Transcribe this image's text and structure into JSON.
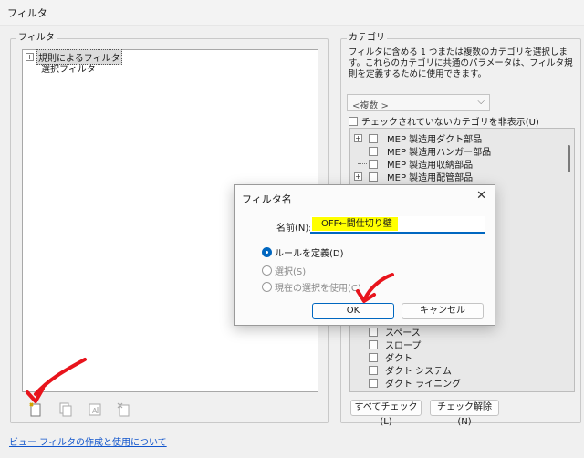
{
  "window": {
    "title": "フィルタ"
  },
  "filters_panel": {
    "label": "フィルタ",
    "tree": [
      {
        "label": "規則によるフィルタ",
        "expand": "+"
      },
      {
        "label": "選択フィルタ"
      }
    ]
  },
  "link": {
    "text": "ビュー フィルタの作成と使用について"
  },
  "categories_panel": {
    "label": "カテゴリ",
    "description": "フィルタに含める 1 つまたは複数のカテゴリを選択します。これらのカテゴリに共通のパラメータは、フィルタ規則を定義するために使用できます。",
    "combo_value": "<複数 >",
    "hide_unchecked_label": "チェックされていないカテゴリを非表示(U)",
    "list_top": [
      {
        "label": "MEP 製造用ダクト部品",
        "expand": "+"
      },
      {
        "label": "MEP 製造用ハンガー部品",
        "expand": ""
      },
      {
        "label": "MEP 製造用収納部品",
        "expand": ""
      },
      {
        "label": "MEP 製造用配管部品",
        "expand": "+"
      }
    ],
    "list_bottom": [
      {
        "label": "スペース"
      },
      {
        "label": "スロープ"
      },
      {
        "label": "ダクト"
      },
      {
        "label": "ダクト システム"
      },
      {
        "label": "ダクト ライニング"
      }
    ],
    "check_all": "すべてチェック(L)",
    "uncheck_all": "チェック解除(N)"
  },
  "dialog": {
    "title": "フィルタ名",
    "name_label": "名前(N):",
    "name_value": "OFF←間仕切り壁",
    "radio_options": [
      {
        "label": "ルールを定義(D)",
        "checked": true,
        "enabled": true
      },
      {
        "label": "選択(S)",
        "checked": false,
        "enabled": false
      },
      {
        "label": "現在の選択を使用(C)",
        "checked": false,
        "enabled": false
      }
    ],
    "ok_label": "OK",
    "cancel_label": "キャンセル"
  },
  "colors": {
    "accent": "#0067c0",
    "highlight": "#ffff00",
    "annotation_arrow": "#e8141c"
  }
}
